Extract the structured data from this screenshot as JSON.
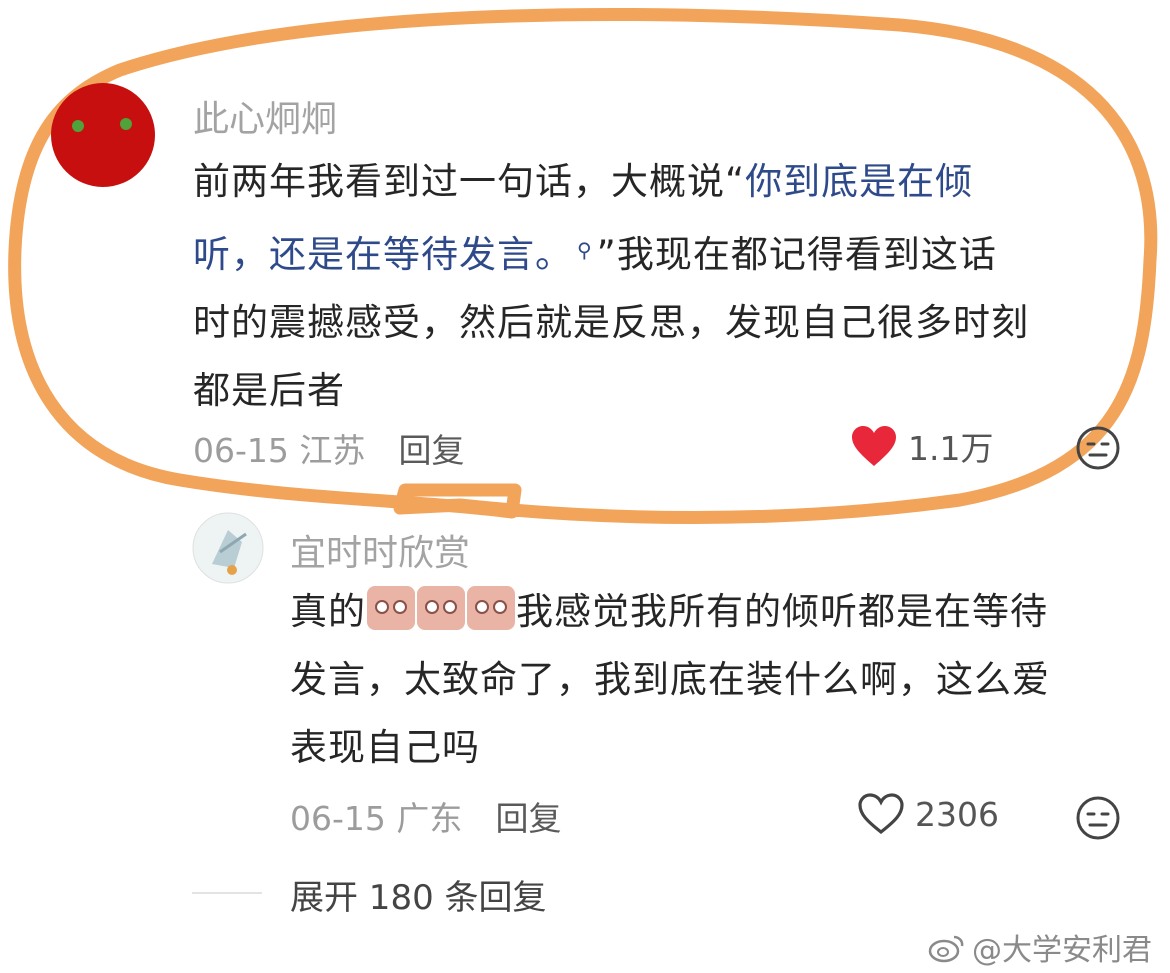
{
  "highlight_color": "#f2a45a",
  "comment": {
    "username": "此心炯炯",
    "text_before": "前两年我看到过一句话，大概说“",
    "quote_line1": "你到底是在倾",
    "quote_line2": "听，还是在等待发言。",
    "text_after_quote": "”我现在都记得看到这话",
    "text_line3": "时的震撼感受，然后就是反思，发现自己很多时刻",
    "text_line4": "都是后者",
    "date_location": "06-15 江苏",
    "reply_label": "回复",
    "like_count": "1.1万",
    "liked": true
  },
  "reply": {
    "username": "宜时时欣赏",
    "text_prefix": "真的",
    "emoji_name": "crying-pig-emoji",
    "text_line1_rest": "我感觉我所有的倾听都是在等待",
    "text_line2": "发言，太致命了，我到底在装什么啊，这么爱",
    "text_line3": "表现自己吗",
    "date_location": "06-15 广东",
    "reply_label": "回复",
    "like_count": "2306",
    "liked": false
  },
  "expand_label": "展开 180 条回复",
  "watermark": "@大学安利君"
}
